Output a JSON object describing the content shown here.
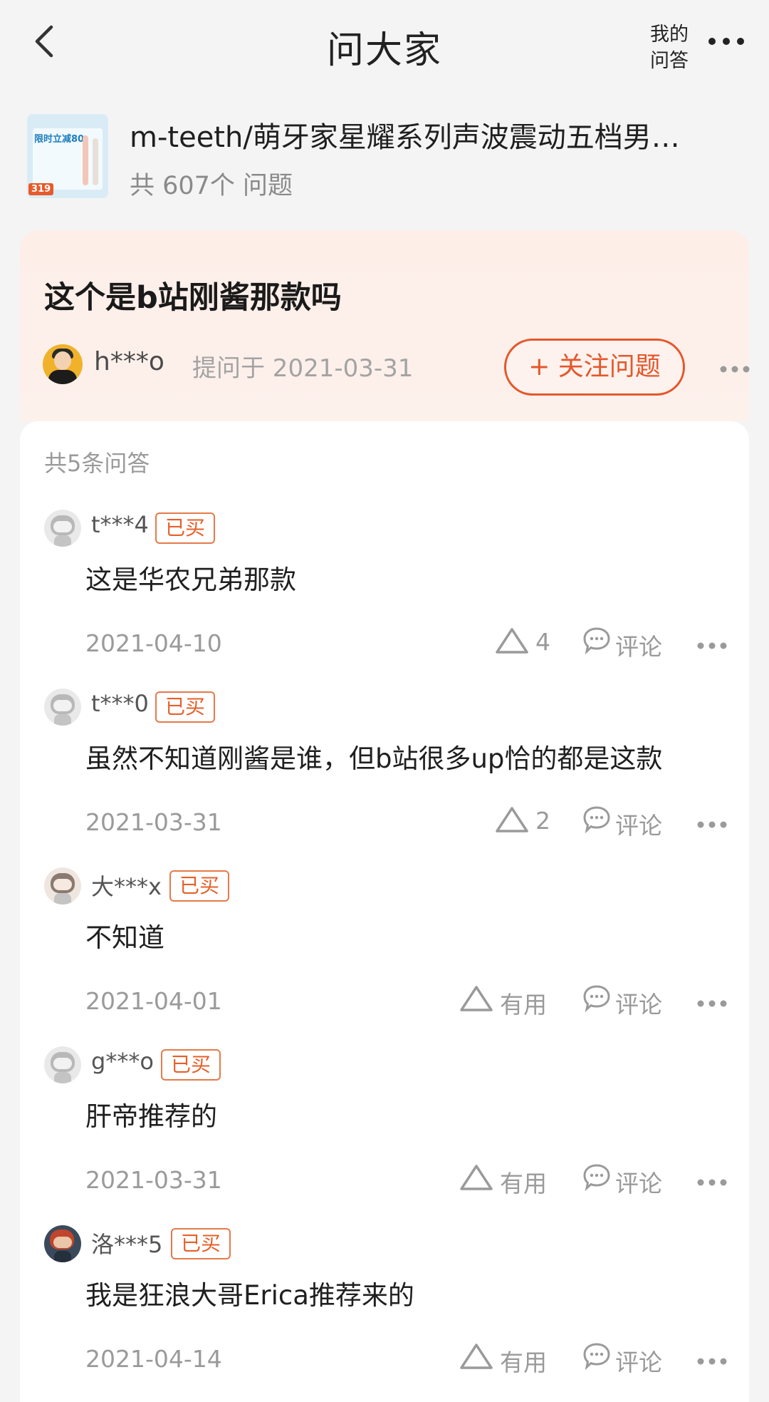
{
  "header": {
    "title": "问大家",
    "my_qa": "我的问答"
  },
  "product": {
    "title": "m-teeth/萌牙家星耀系列声波震动五档男…",
    "question_count": "共 607个 问题",
    "thumb_promo": "限时立减80",
    "thumb_price": "319"
  },
  "question": {
    "title": "这个是b站刚酱那款吗",
    "asker": "h***o",
    "asked_at": "提问于 2021-03-31",
    "follow_label": "+ 关注问题"
  },
  "answers_header": "共5条问答",
  "answers": [
    {
      "user": "t***4",
      "tag": "已买",
      "text": "这是华农兄弟那款",
      "date": "2021-04-10",
      "useful": "4",
      "comment": "评论"
    },
    {
      "user": "t***0",
      "tag": "已买",
      "text": "虽然不知道刚酱是谁，但b站很多up恰的都是这款",
      "date": "2021-03-31",
      "useful": "2",
      "comment": "评论"
    },
    {
      "user": "大***x",
      "tag": "已买",
      "text": "不知道",
      "date": "2021-04-01",
      "useful": "有用",
      "comment": "评论"
    },
    {
      "user": "g***o",
      "tag": "已买",
      "text": "肝帝推荐的",
      "date": "2021-03-31",
      "useful": "有用",
      "comment": "评论"
    },
    {
      "user": "洛***5",
      "tag": "已买",
      "text": "我是狂浪大哥Erica推荐来的",
      "date": "2021-04-14",
      "useful": "有用",
      "comment": "评论"
    }
  ],
  "colors": {
    "accent": "#e5572a",
    "question_bg": "#fdeee8",
    "page_bg": "#f4f4f4"
  }
}
